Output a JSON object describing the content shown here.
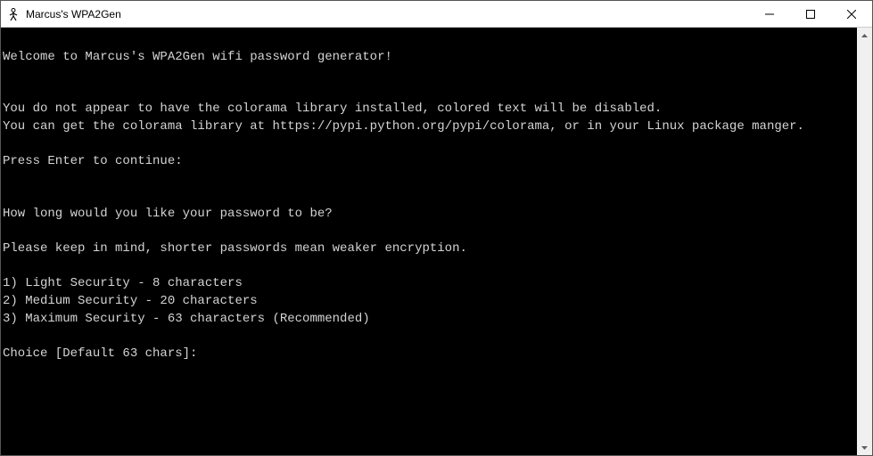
{
  "titlebar": {
    "title": "Marcus's WPA2Gen"
  },
  "terminal": {
    "lines": [
      "",
      "Welcome to Marcus's WPA2Gen wifi password generator!",
      "",
      "",
      "You do not appear to have the colorama library installed, colored text will be disabled.",
      "You can get the colorama library at https://pypi.python.org/pypi/colorama, or in your Linux package manger.",
      "",
      "Press Enter to continue:",
      "",
      "",
      "How long would you like your password to be?",
      "",
      "Please keep in mind, shorter passwords mean weaker encryption.",
      "",
      "1) Light Security - 8 characters",
      "2) Medium Security - 20 characters",
      "3) Maximum Security - 63 characters (Recommended)",
      "",
      "Choice [Default 63 chars]:"
    ]
  }
}
